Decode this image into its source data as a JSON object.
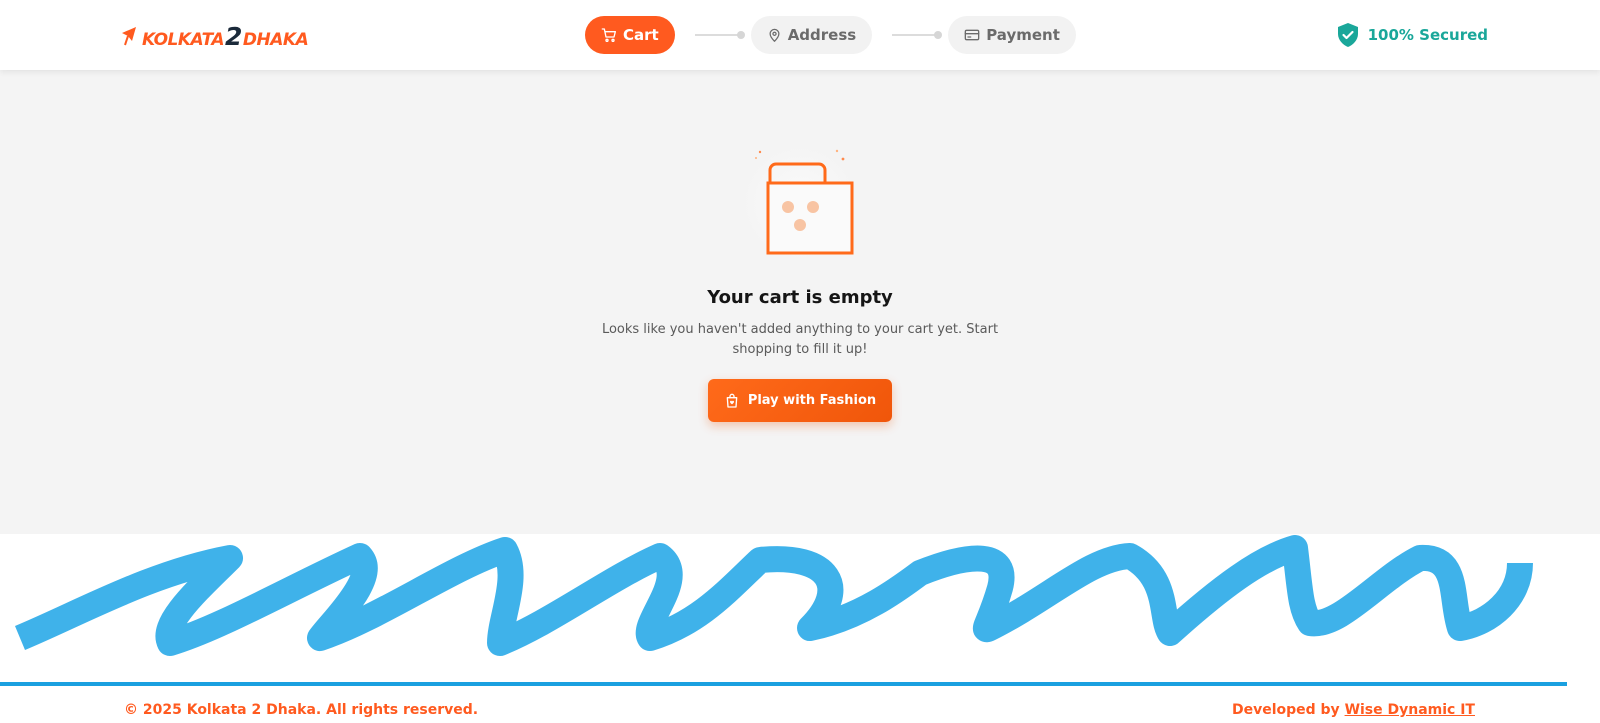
{
  "header": {
    "logo": {
      "prefix": "KOLKATA",
      "number": "2",
      "suffix": "DHAKA"
    },
    "steps": [
      {
        "label": "Cart",
        "icon": "cart-icon",
        "active": true
      },
      {
        "label": "Address",
        "icon": "map-pin-icon",
        "active": false
      },
      {
        "label": "Payment",
        "icon": "credit-card-icon",
        "active": false
      }
    ],
    "secured_label": "100% Secured"
  },
  "main": {
    "title": "Your cart is empty",
    "description": "Looks like you haven't added anything to your cart yet. Start shopping to fill it up!",
    "cta_label": "Play with Fashion"
  },
  "footer": {
    "copyright": "© 2025 Kolkata 2 Dhaka. All rights reserved.",
    "developed_by_prefix": "Developed by ",
    "developer_name": "Wise Dynamic IT"
  },
  "colors": {
    "accent": "#ff5a1f",
    "secured": "#1aa79a",
    "scribble": "#1aa0e0",
    "background": "#f4f4f4"
  }
}
